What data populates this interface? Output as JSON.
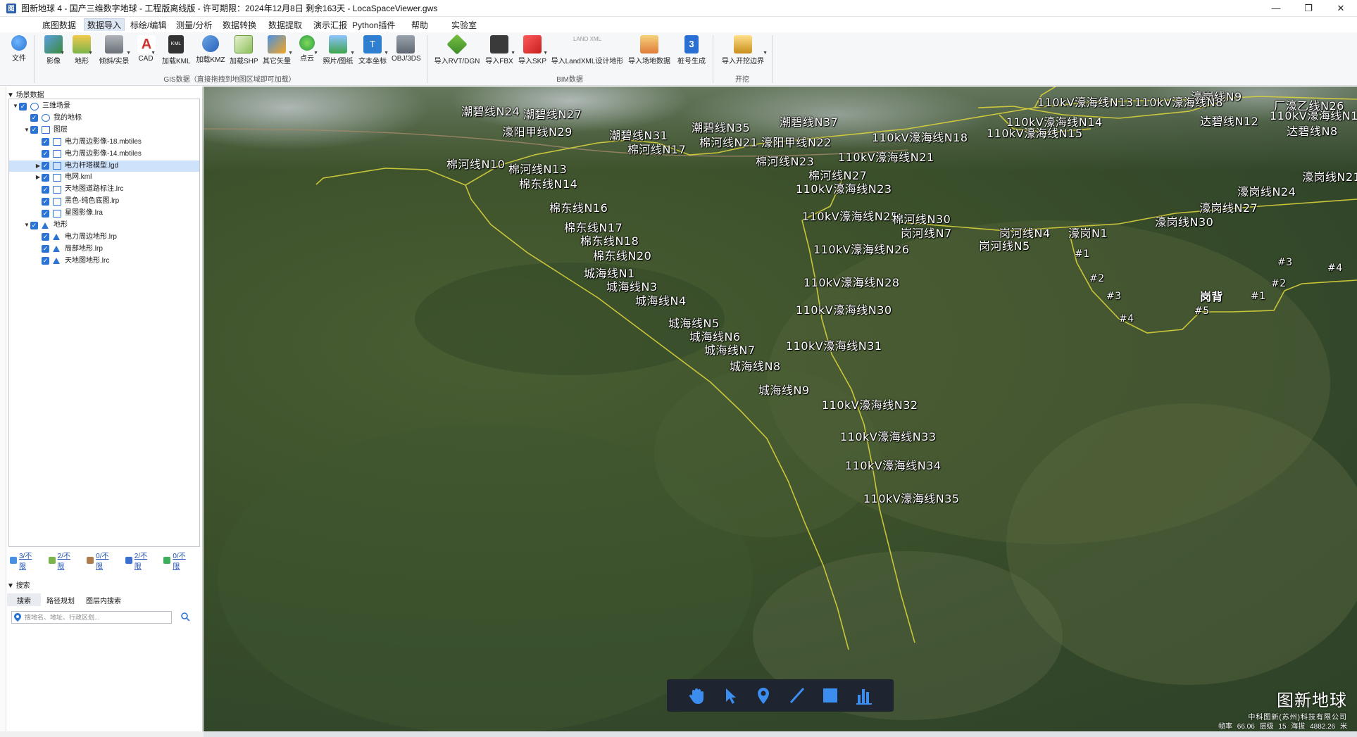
{
  "window": {
    "title": "图新地球 4 - 国产三维数字地球 - 工程版离线版 - 许可期限：2024年12月8日 剩余163天 - LocaSpaceViewer.gws",
    "controls": [
      "minimize",
      "restore",
      "close"
    ]
  },
  "menu": {
    "items": [
      "底图数据",
      "数据导入",
      "标绘/编辑",
      "测量/分析",
      "数据转换",
      "数据提取",
      "演示汇报",
      "Python插件",
      "帮助",
      "实验室"
    ],
    "active": "数据导入"
  },
  "ribbon": {
    "file_label": "文件",
    "gis_buttons": [
      "影像",
      "地形",
      "倾斜/实景",
      "CAD",
      "加载KML",
      "加载KMZ",
      "加载SHP",
      "其它矢量",
      "点云",
      "照片/图纸",
      "文本坐标",
      "OBJ/3DS"
    ],
    "gis_group_label": "GIS数据（直接拖拽到地图区域即可加载）",
    "bim_buttons": [
      "导入RVT/DGN",
      "导入FBX",
      "导入SKP",
      "导入LandXML设计地形",
      "导入场地数据",
      "桩号生成"
    ],
    "bim_group_label": "BIM数据",
    "dig_buttons": [
      "导入开挖边界"
    ],
    "dig_group_label": "开挖",
    "landxml_badge": "LAND XML"
  },
  "left_panel": {
    "scene_header": "场景数据",
    "tree": [
      {
        "label": "三维场景",
        "level": 0,
        "expand": "▼",
        "icon": "globe-icon"
      },
      {
        "label": "我的地标",
        "level": 1,
        "expand": "",
        "icon": "placemark-icon"
      },
      {
        "label": "图层",
        "level": 1,
        "expand": "▼",
        "icon": "layers-icon"
      },
      {
        "label": "电力周边影像-18.mbtiles",
        "level": 2,
        "expand": "",
        "icon": "image-layer-icon"
      },
      {
        "label": "电力周边影像-14.mbtiles",
        "level": 2,
        "expand": "",
        "icon": "image-layer-icon"
      },
      {
        "label": "电力杆塔模型.lgd",
        "level": 2,
        "expand": "▶",
        "icon": "vector-layer-icon",
        "selected": true
      },
      {
        "label": "电网.kml",
        "level": 2,
        "expand": "▶",
        "icon": "vector-layer-icon"
      },
      {
        "label": "天地图道路标注.lrc",
        "level": 2,
        "expand": "",
        "icon": "image-layer-icon"
      },
      {
        "label": "黑色-纯色底图.lrp",
        "level": 2,
        "expand": "",
        "icon": "image-layer-icon"
      },
      {
        "label": "星图影像.lra",
        "level": 2,
        "expand": "",
        "icon": "image-layer-icon"
      },
      {
        "label": "地形",
        "level": 1,
        "expand": "▼",
        "icon": "terrain-icon"
      },
      {
        "label": "电力周边地形.lrp",
        "level": 2,
        "expand": "",
        "icon": "terrain-layer-icon"
      },
      {
        "label": "局部地形.lrp",
        "level": 2,
        "expand": "",
        "icon": "terrain-layer-icon"
      },
      {
        "label": "天地图地形.lrc",
        "level": 2,
        "expand": "",
        "icon": "terrain-layer-icon"
      }
    ],
    "stats": [
      "3/不限",
      "2/不限",
      "0/不限",
      "2/不限",
      "0/不限"
    ],
    "search_header": "搜索",
    "search_tabs": [
      "搜索",
      "路径规划",
      "图层内搜索"
    ],
    "search_placeholder": "搜地名、地址、行政区划..."
  },
  "map": {
    "labels": [
      "潮碧线N24",
      "潮碧线N27",
      "濠阳甲线N29",
      "潮碧线N31",
      "潮碧线N35",
      "潮碧线N37",
      "棉河线N21",
      "濠阳甲线N22",
      "棉河线N17",
      "棉河线N10",
      "棉河线N13",
      "棉东线N14",
      "棉河线N23",
      "110kV濠海线N18",
      "110kV濠海线N21",
      "棉河线N27",
      "110kV濠海线N23",
      "棉东线N16",
      "110kV濠海线N25",
      "棉河线N30",
      "岗河线N7",
      "岗河线N4",
      "濠岗N1",
      "岗河线N5",
      "棉东线N17",
      "棉东线N18",
      "棉东线N20",
      "110kV濠海线N26",
      "城海线N1",
      "城海线N3",
      "城海线N4",
      "110kV濠海线N28",
      "110kV濠海线N30",
      "城海线N5",
      "城海线N6",
      "城海线N7",
      "110kV濠海线N31",
      "城海线N8",
      "城海线N9",
      "110kV濠海线N32",
      "110kV濠海线N33",
      "110kV濠海线N34",
      "110kV濠海线N35",
      "濠岗线N9",
      "110kV濠海线N13",
      "110kV濠海线N8",
      "110kV濠海线N1",
      "厂濠乙线N26",
      "110kV濠海线N14",
      "达碧线N12",
      "110kV濠海线N15",
      "达碧线N8",
      "濠岗线N21",
      "濠岗线N24",
      "濠岗线N27",
      "濠岗线N30",
      "#1",
      "#2",
      "#3",
      "#4",
      "#5",
      "岗背",
      "#1",
      "#2",
      "#3",
      "#4"
    ],
    "toolbar": [
      "hand-icon",
      "pointer-icon",
      "placemark-icon",
      "line-icon",
      "polygon-icon",
      "chart-icon"
    ],
    "brand_title": "图新地球",
    "brand_company": "中科图新(苏州)科技有限公司",
    "status_text": "帧率 66.06   层级 15   海拔 4882.26 米",
    "colors": {
      "power_line": "#d8d23c",
      "terrain": "#3a4f2a",
      "ribbon": "#f6f7f9",
      "accent": "#2b74d6"
    }
  }
}
